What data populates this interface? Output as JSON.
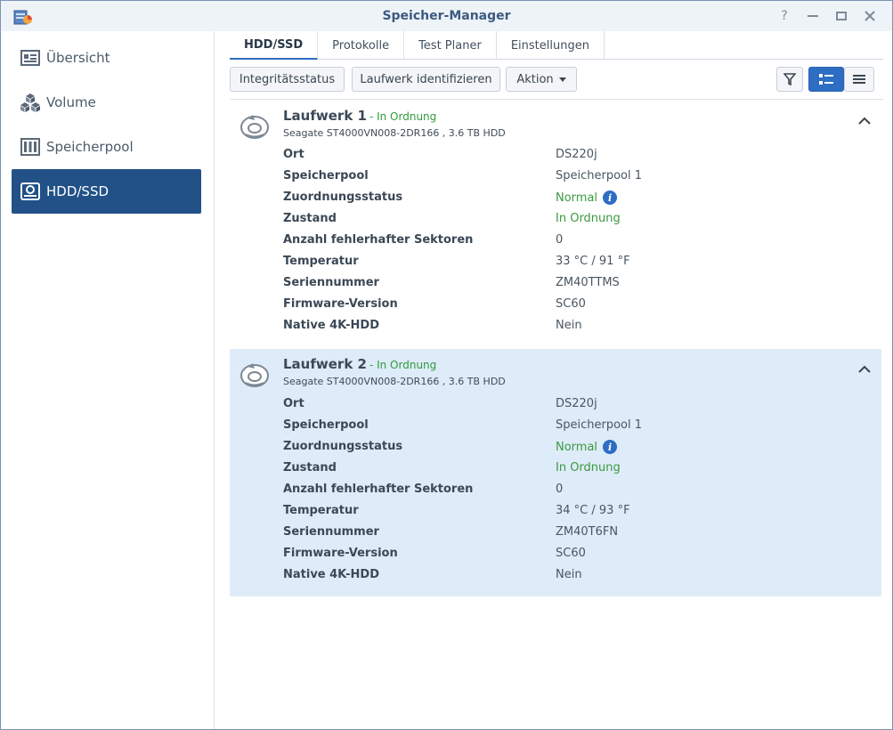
{
  "window": {
    "title": "Speicher-Manager"
  },
  "sidebar": {
    "items": [
      {
        "label": "Übersicht",
        "icon": "overview-icon"
      },
      {
        "label": "Volume",
        "icon": "cubes-icon"
      },
      {
        "label": "Speicherpool",
        "icon": "pool-icon"
      },
      {
        "label": "HDD/SSD",
        "icon": "hdd-icon",
        "active": true
      }
    ]
  },
  "tabs": [
    {
      "label": "HDD/SSD",
      "active": true
    },
    {
      "label": "Protokolle"
    },
    {
      "label": "Test Planer"
    },
    {
      "label": "Einstellungen"
    }
  ],
  "toolbar": {
    "integrity_label": "Integritätsstatus",
    "identify_label": "Laufwerk identifizieren",
    "action_label": "Aktion"
  },
  "colors": {
    "accent": "#2d6dc4",
    "sidebar_active": "#215187",
    "ok": "#3b9a3f",
    "highlight": "#deebf9"
  },
  "disks": [
    {
      "title": "Laufwerk 1",
      "status": "- In Ordnung",
      "model": "Seagate ST4000VN008-2DR166 , 3.6 TB HDD",
      "details": [
        {
          "label": "Ort",
          "value": "DS220j"
        },
        {
          "label": "Speicherpool",
          "value": "Speicherpool 1"
        },
        {
          "label": "Zuordnungsstatus",
          "value": "Normal"
        },
        {
          "label": "Zustand",
          "value": "In Ordnung"
        },
        {
          "label": "Anzahl fehlerhafter Sektoren",
          "value": "0"
        },
        {
          "label": "Temperatur",
          "value": "33 °C / 91 °F"
        },
        {
          "label": "Seriennummer",
          "value": "ZM40TTMS"
        },
        {
          "label": "Firmware-Version",
          "value": "SC60"
        },
        {
          "label": "Native 4K-HDD",
          "value": "Nein"
        }
      ]
    },
    {
      "title": "Laufwerk 2",
      "status": "- In Ordnung",
      "model": "Seagate ST4000VN008-2DR166 , 3.6 TB HDD",
      "details": [
        {
          "label": "Ort",
          "value": "DS220j"
        },
        {
          "label": "Speicherpool",
          "value": "Speicherpool 1"
        },
        {
          "label": "Zuordnungsstatus",
          "value": "Normal"
        },
        {
          "label": "Zustand",
          "value": "In Ordnung"
        },
        {
          "label": "Anzahl fehlerhafter Sektoren",
          "value": "0"
        },
        {
          "label": "Temperatur",
          "value": "34 °C / 93 °F"
        },
        {
          "label": "Seriennummer",
          "value": "ZM40T6FN"
        },
        {
          "label": "Firmware-Version",
          "value": "SC60"
        },
        {
          "label": "Native 4K-HDD",
          "value": "Nein"
        }
      ]
    }
  ]
}
